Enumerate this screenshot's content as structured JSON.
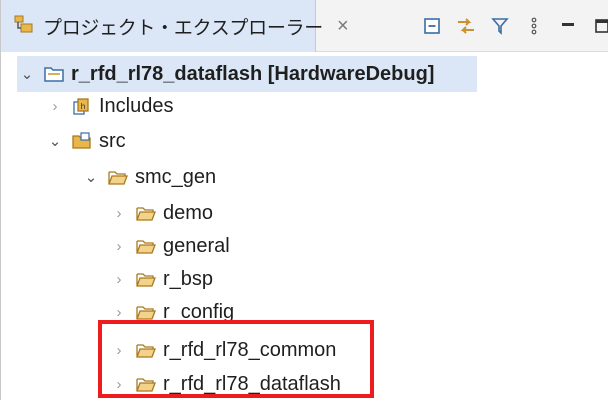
{
  "view": {
    "title": "プロジェクト・エクスプローラー",
    "close_glyph": "×"
  },
  "toolbar": {
    "buttons": [
      {
        "name": "collapse-all-icon"
      },
      {
        "name": "link-with-editor-icon"
      },
      {
        "name": "filter-icon"
      },
      {
        "name": "view-menu-icon"
      },
      {
        "name": "minimize-icon"
      },
      {
        "name": "maximize-icon"
      }
    ]
  },
  "tree": {
    "project": {
      "label": "r_rfd_rl78_dataflash [HardwareDebug]",
      "expanded": true
    },
    "includes": {
      "label": "Includes",
      "expanded": false
    },
    "src": {
      "label": "src",
      "expanded": true
    },
    "smc_gen": {
      "label": "smc_gen",
      "expanded": true
    },
    "children": [
      {
        "label": "demo"
      },
      {
        "label": "general"
      },
      {
        "label": "r_bsp"
      },
      {
        "label": "r_config"
      },
      {
        "label": "r_rfd_rl78_common"
      },
      {
        "label": "r_rfd_rl78_dataflash"
      }
    ]
  },
  "colors": {
    "selection": "#dbe7f6",
    "highlight_box": "#ee1c1c",
    "folder": "#e8b64a"
  }
}
